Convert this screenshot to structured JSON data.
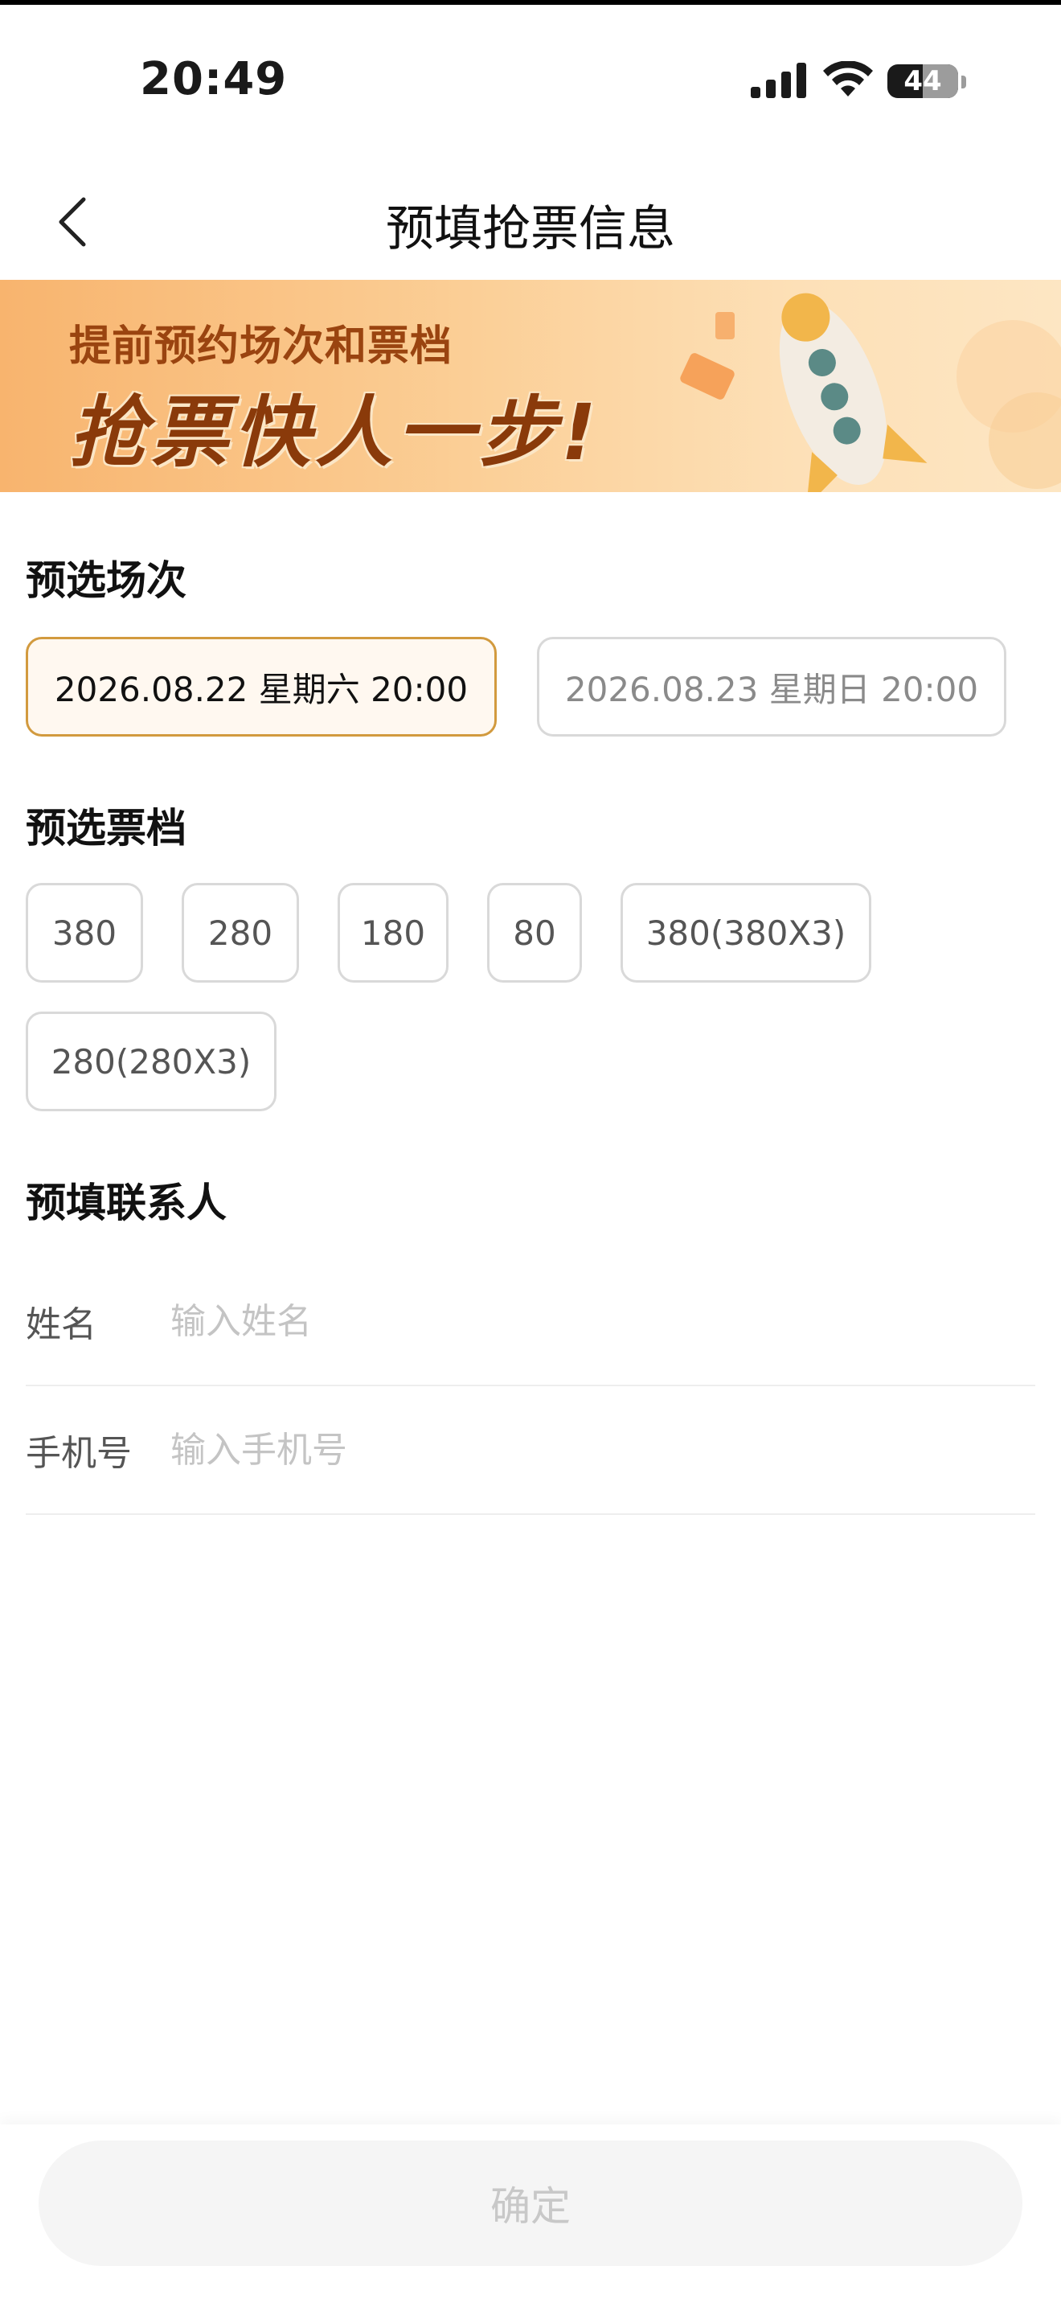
{
  "status_bar": {
    "time": "20:49",
    "battery_level": "44",
    "icons": [
      "signal-icon",
      "wifi-icon",
      "battery-icon"
    ]
  },
  "nav": {
    "title": "预填抢票信息",
    "back_icon": "chevron-left-icon"
  },
  "banner": {
    "line1": "提前预约场次和票档",
    "line2": "抢票快人一步!",
    "art": "rocket-illustration"
  },
  "sessions": {
    "title": "预选场次",
    "options": [
      {
        "label": "2026.08.22 星期六 20:00",
        "selected": true
      },
      {
        "label": "2026.08.23 星期日 20:00",
        "selected": false
      }
    ]
  },
  "tiers": {
    "title": "预选票档",
    "options": [
      "380",
      "280",
      "180",
      "80",
      "380(380X3)",
      "280(280X3)"
    ]
  },
  "contact": {
    "title": "预填联系人",
    "name_label": "姓名",
    "name_placeholder": "输入姓名",
    "phone_label": "手机号",
    "phone_placeholder": "输入手机号"
  },
  "confirm_label": "确定",
  "colors": {
    "accent_border": "#d29a3e",
    "selected_bg": "#fff8f0",
    "banner_text": "#8a3a0a"
  }
}
